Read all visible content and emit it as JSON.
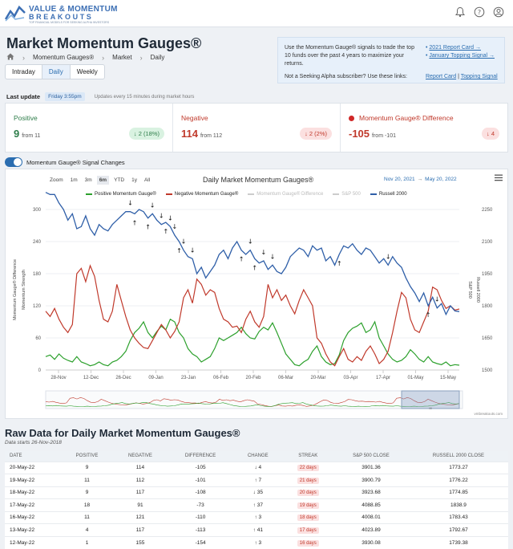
{
  "header": {
    "logo_line1": "VALUE & MOMENTUM",
    "logo_line2": "BREAKOUTS",
    "logo_tagline": "TOP FINANCIAL MODELS FOR SEEKING ALPHA INVESTORS",
    "icons": [
      "bell-icon",
      "help-icon",
      "user-icon"
    ]
  },
  "page": {
    "title": "Market Momentum Gauges®",
    "breadcrumb": [
      "Momentum Gauges®",
      "Market",
      "Daily"
    ],
    "tabs": [
      {
        "label": "Intraday",
        "active": false
      },
      {
        "label": "Daily",
        "active": true
      },
      {
        "label": "Weekly",
        "active": false
      }
    ]
  },
  "info": {
    "text": "Use the Momentum Gauge® signals to trade the top 10 funds over the past 4 years to maximize your returns.",
    "question": "Not a Seeking Alpha subscriber? Use these links:",
    "link1": "2021 Report Card →",
    "link2": "January Topping Signal →",
    "link3": "Report Card",
    "link_sep": "|",
    "link4": "Topping Signal"
  },
  "update": {
    "label": "Last update",
    "time": "Friday 3:55pm",
    "note": "Updates every 15 minutes during market hours"
  },
  "gauges": {
    "positive": {
      "label": "Positive",
      "value": "9",
      "from": "from 11",
      "change": "↓ 2 (18%)"
    },
    "negative": {
      "label": "Negative",
      "value": "114",
      "from": "from 112",
      "change": "↓ 2 (2%)"
    },
    "difference": {
      "label": "Momentum Gauge® Difference",
      "value": "-105",
      "from": "from -101",
      "change": "↓ 4"
    }
  },
  "toggle": {
    "label": "Momentum Gauge® Signal Changes",
    "on": true
  },
  "chart_ui": {
    "zoom_label": "Zoom",
    "zoom_options": [
      "1m",
      "3m",
      "6m",
      "YTD",
      "1y",
      "All"
    ],
    "zoom_selected": "6m",
    "title": "Daily Market Momentum Gauges®",
    "range_from": "Nov 20, 2021",
    "range_sep": "→",
    "range_to": "May 20, 2022",
    "credit": "vmbreakouts.com",
    "nav_handle": "III"
  },
  "chart_data": {
    "type": "line",
    "title": "Daily Market Momentum Gauges®",
    "ylabel_left": "Momentum Gauge® Difference",
    "ylabel_left2": "Momentum Strength",
    "ylabel_right": "S&P 500",
    "ylabel_right2": "Russell 2000",
    "ylim_left": [
      0,
      300
    ],
    "yticks_left": [
      "0",
      "60",
      "120",
      "180",
      "240",
      "300"
    ],
    "ylim_right": [
      1500,
      2250
    ],
    "yticks_right": [
      "1500",
      "1650",
      "1800",
      "1950",
      "2100",
      "2250"
    ],
    "xticks": [
      "28-Nov",
      "12-Dec",
      "26-Dec",
      "09-Jan",
      "23-Jan",
      "06-Feb",
      "20-Feb",
      "06-Mar",
      "20-Mar",
      "03-Apr",
      "17-Apr",
      "01-May",
      "15-May"
    ],
    "colors": {
      "positive": "#2ca02c",
      "negative": "#c0392b",
      "difference": "#c8c8c8",
      "sp500": "#c8c8c8",
      "russell": "#2f5fa8"
    },
    "series": [
      {
        "name": "Positive Momentum Gauge®",
        "visible": true,
        "values": [
          25,
          28,
          20,
          30,
          22,
          18,
          15,
          25,
          15,
          12,
          8,
          10,
          15,
          10,
          8,
          15,
          18,
          25,
          35,
          55,
          70,
          78,
          90,
          70,
          60,
          72,
          82,
          75,
          95,
          90,
          70,
          60,
          40,
          30,
          25,
          15,
          20,
          25,
          40,
          60,
          55,
          60,
          65,
          70,
          80,
          68,
          60,
          58,
          72,
          80,
          75,
          88,
          70,
          50,
          30,
          20,
          10,
          8,
          15,
          20,
          35,
          45,
          25,
          15,
          10,
          12,
          28,
          55,
          70,
          78,
          82,
          88,
          70,
          75,
          90,
          60,
          45,
          30,
          20,
          15,
          18,
          25,
          38,
          30,
          20,
          15,
          25,
          15,
          12,
          10,
          15,
          8,
          10,
          9
        ]
      },
      {
        "name": "Negative Momentum Gauge®",
        "visible": true,
        "values": [
          110,
          100,
          115,
          95,
          80,
          70,
          85,
          180,
          190,
          165,
          195,
          175,
          130,
          95,
          90,
          110,
          160,
          130,
          100,
          75,
          60,
          50,
          42,
          40,
          55,
          70,
          85,
          75,
          60,
          72,
          90,
          135,
          150,
          125,
          170,
          160,
          140,
          150,
          145,
          115,
          95,
          90,
          80,
          82,
          70,
          95,
          110,
          90,
          80,
          100,
          160,
          135,
          150,
          130,
          140,
          120,
          105,
          130,
          150,
          135,
          120,
          60,
          50,
          30,
          15,
          8,
          25,
          40,
          20,
          15,
          25,
          18,
          35,
          45,
          30,
          12,
          20,
          35,
          70,
          110,
          145,
          135,
          95,
          75,
          70,
          90,
          110,
          155,
          150,
          130,
          115,
          120,
          112,
          114
        ]
      },
      {
        "name": "Momentum Gauge® Difference",
        "visible": false,
        "values": []
      },
      {
        "name": "S&P 500",
        "visible": false,
        "values": []
      },
      {
        "name": "Russell 2000",
        "visible": true,
        "values": [
          2330,
          2320,
          2320,
          2280,
          2250,
          2200,
          2230,
          2160,
          2170,
          2220,
          2160,
          2130,
          2180,
          2160,
          2150,
          2180,
          2200,
          2220,
          2240,
          2240,
          2230,
          2250,
          2240,
          2210,
          2230,
          2200,
          2180,
          2190,
          2170,
          2130,
          2100,
          2060,
          2030,
          2020,
          1950,
          1980,
          1930,
          1960,
          1990,
          2040,
          2060,
          2020,
          2070,
          2100,
          2060,
          2040,
          2060,
          2020,
          2000,
          2010,
          1970,
          1990,
          1960,
          1950,
          1980,
          2030,
          2050,
          2070,
          2060,
          2030,
          2080,
          2060,
          2070,
          2010,
          2030,
          1990,
          2040,
          2080,
          2070,
          2090,
          2060,
          2040,
          2070,
          2060,
          2030,
          2000,
          2020,
          1990,
          2030,
          2000,
          1980,
          1930,
          1890,
          1860,
          1820,
          1860,
          1800,
          1840,
          1790,
          1810,
          1760,
          1800,
          1776,
          1773
        ]
      }
    ],
    "signal_arrows": [
      {
        "dir": "down",
        "index": 19
      },
      {
        "dir": "up",
        "index": 20
      },
      {
        "dir": "up",
        "index": 23
      },
      {
        "dir": "down",
        "index": 24
      },
      {
        "dir": "down",
        "index": 26
      },
      {
        "dir": "up",
        "index": 27
      },
      {
        "dir": "down",
        "index": 28
      },
      {
        "dir": "down",
        "index": 29
      },
      {
        "dir": "up",
        "index": 30
      },
      {
        "dir": "down",
        "index": 31
      },
      {
        "dir": "down",
        "index": 33
      },
      {
        "dir": "up",
        "index": 44
      },
      {
        "dir": "down",
        "index": 46
      },
      {
        "dir": "up",
        "index": 47
      },
      {
        "dir": "down",
        "index": 49
      },
      {
        "dir": "down",
        "index": 51
      },
      {
        "dir": "up",
        "index": 66
      },
      {
        "dir": "down",
        "index": 77
      },
      {
        "dir": "up",
        "index": 86
      },
      {
        "dir": "down",
        "index": 88
      }
    ]
  },
  "raw": {
    "title": "Raw Data for Daily Market Momentum Gauges®",
    "subtitle": "Data starts 26-Nov-2018",
    "headers": [
      "DATE",
      "POSITIVE",
      "NEGATIVE",
      "DIFFERENCE",
      "CHANGE",
      "STREAK",
      "S&P 500 CLOSE",
      "RUSSELL 2000 CLOSE"
    ],
    "rows": [
      {
        "date": "20-May-22",
        "pos": "9",
        "neg": "114",
        "diff": "-105",
        "dir": "↓",
        "chg": "4",
        "streak": "22 days",
        "sp": "3901.36",
        "rut": "1773.27"
      },
      {
        "date": "19-May-22",
        "pos": "11",
        "neg": "112",
        "diff": "-101",
        "dir": "↑",
        "chg": "7",
        "streak": "21 days",
        "sp": "3900.79",
        "rut": "1776.22"
      },
      {
        "date": "18-May-22",
        "pos": "9",
        "neg": "117",
        "diff": "-108",
        "dir": "↓",
        "chg": "35",
        "streak": "20 days",
        "sp": "3923.68",
        "rut": "1774.85"
      },
      {
        "date": "17-May-22",
        "pos": "18",
        "neg": "91",
        "diff": "-73",
        "dir": "↑",
        "chg": "37",
        "streak": "19 days",
        "sp": "4088.85",
        "rut": "1838.9"
      },
      {
        "date": "16-May-22",
        "pos": "11",
        "neg": "121",
        "diff": "-110",
        "dir": "↑",
        "chg": "3",
        "streak": "18 days",
        "sp": "4008.01",
        "rut": "1783.43"
      },
      {
        "date": "13-May-22",
        "pos": "4",
        "neg": "117",
        "diff": "-113",
        "dir": "↑",
        "chg": "41",
        "streak": "17 days",
        "sp": "4023.89",
        "rut": "1792.67"
      },
      {
        "date": "12-May-22",
        "pos": "1",
        "neg": "155",
        "diff": "-154",
        "dir": "↑",
        "chg": "3",
        "streak": "16 days",
        "sp": "3930.08",
        "rut": "1739.38"
      }
    ]
  }
}
